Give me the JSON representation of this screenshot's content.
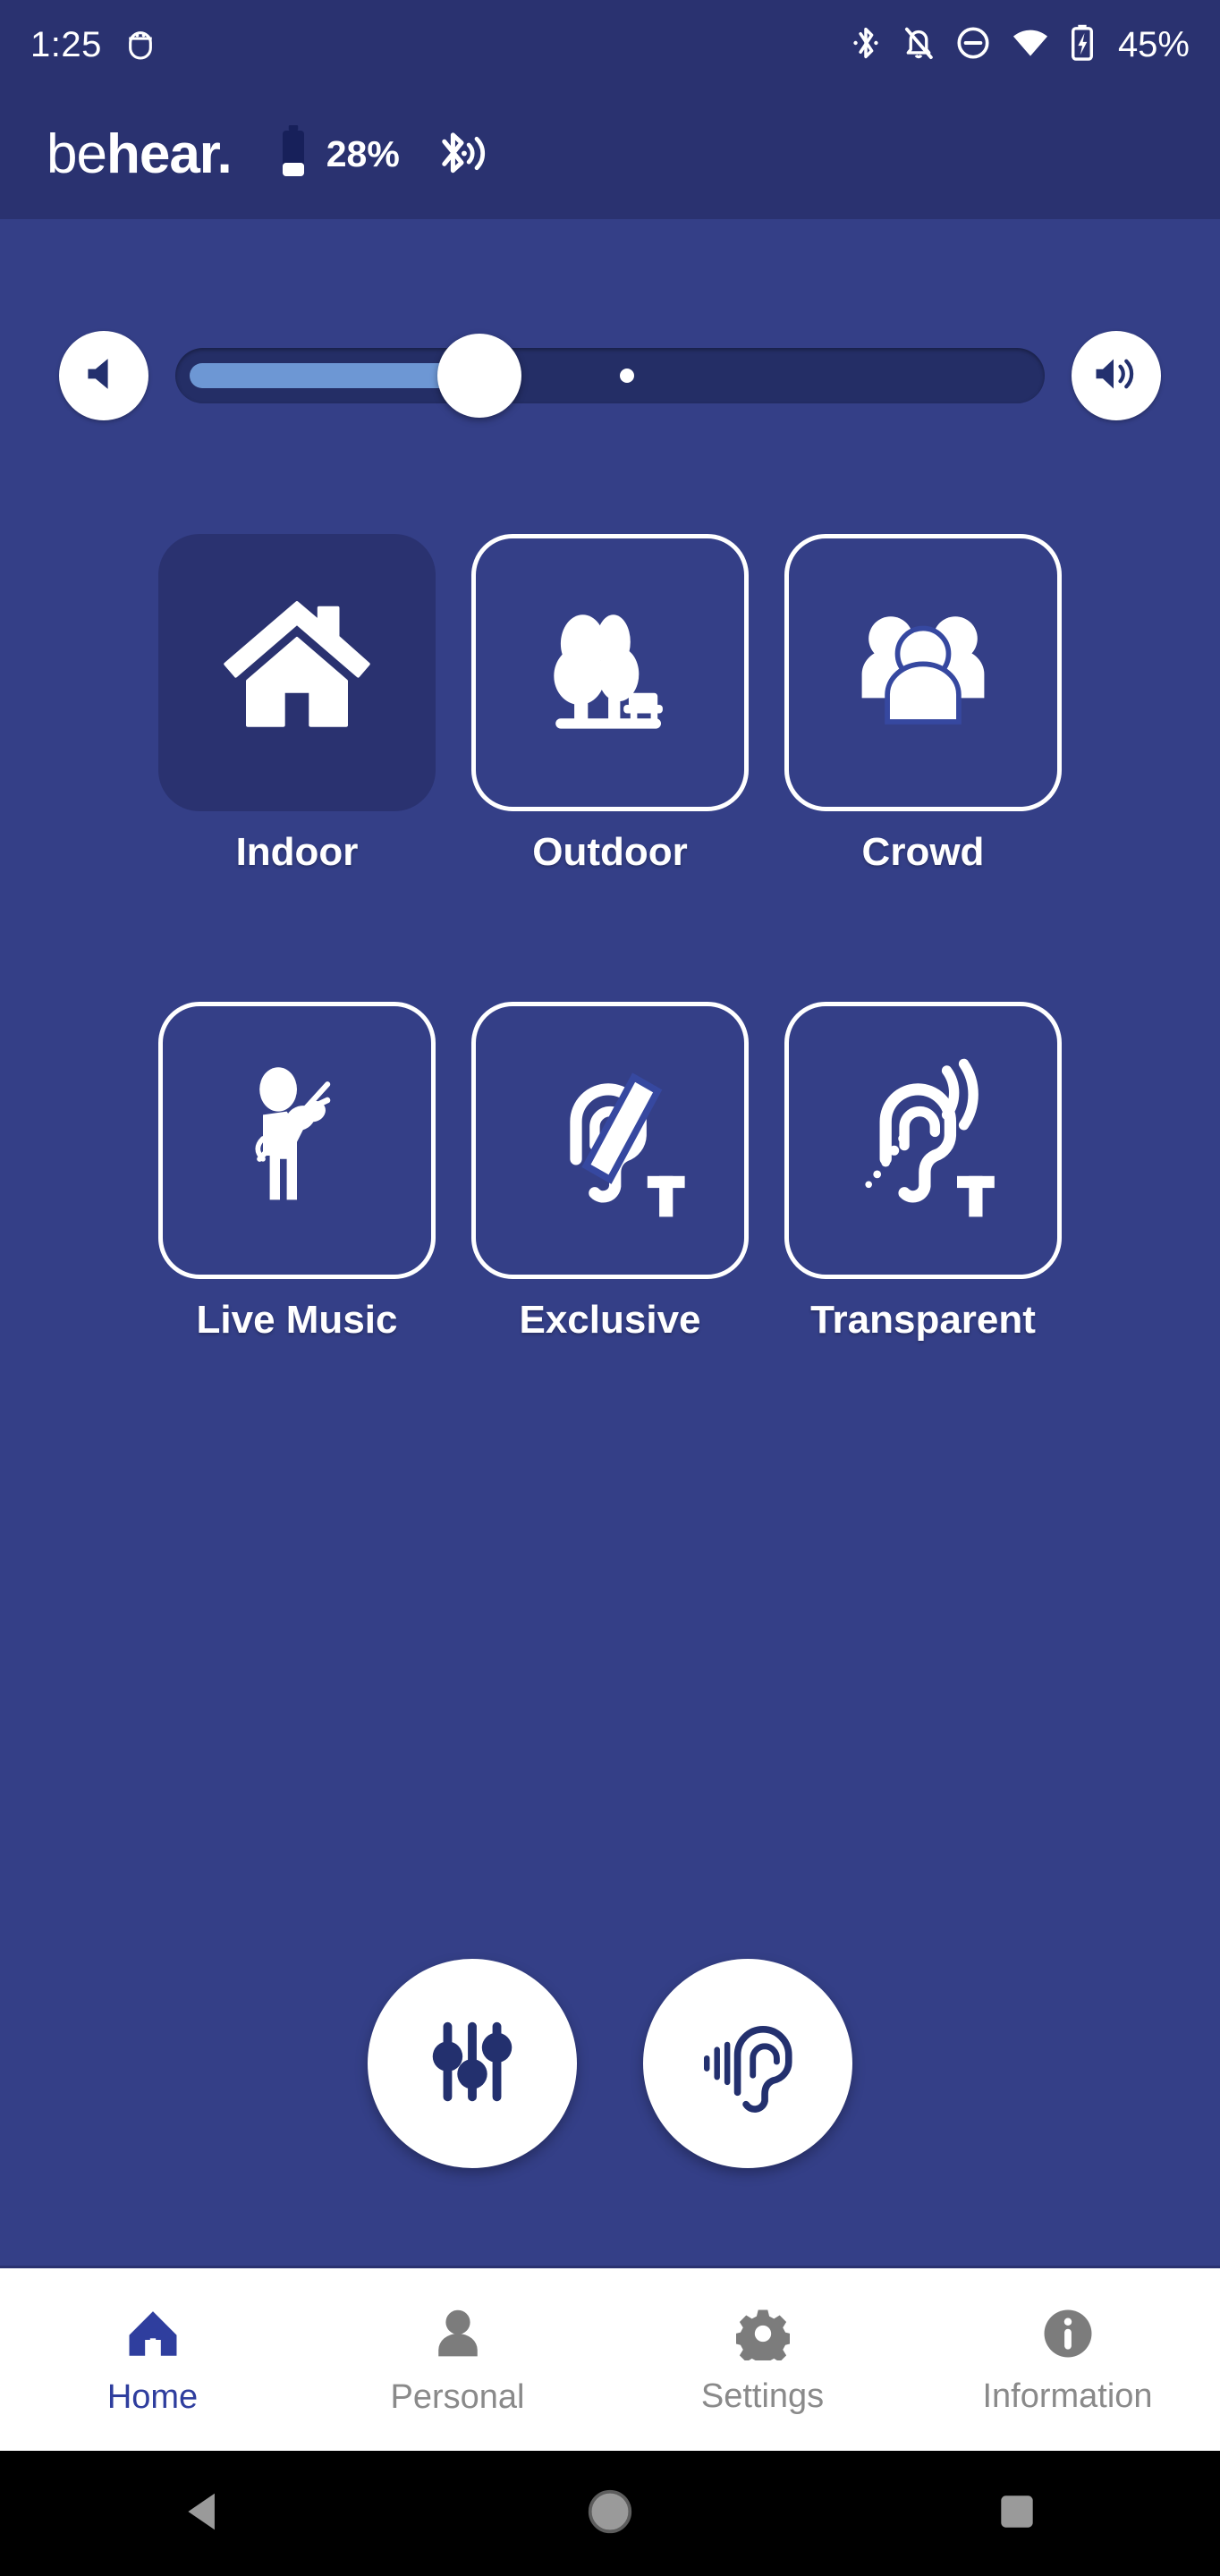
{
  "status_bar": {
    "clock": "1:25",
    "battery_percent": "45%",
    "icons": [
      "android-debug-icon",
      "bluetooth-icon",
      "notifications-off-icon",
      "do-not-disturb-icon",
      "wifi-icon",
      "battery-charging-icon"
    ],
    "background_color": "#2a3270",
    "text_color": "#ffffff"
  },
  "app_header": {
    "logo_light": "be",
    "logo_bold": "hear.",
    "device_battery_percent": "28%",
    "bluetooth_state_icon": "bluetooth-connected-icon",
    "background_color": "#2a3270"
  },
  "volume": {
    "decrease_icon": "volume-down-icon",
    "increase_icon": "volume-up-icon",
    "value_percent": 35,
    "default_marker_percent": 52,
    "track_color": "#242e66",
    "fill_color": "#6d97d4",
    "thumb_color": "#ffffff"
  },
  "modes": {
    "selected": "Indoor",
    "row1": [
      {
        "label": "Indoor",
        "icon": "house-icon",
        "selected": true
      },
      {
        "label": "Outdoor",
        "icon": "trees-bench-icon",
        "selected": false
      },
      {
        "label": "Crowd",
        "icon": "people-group-icon",
        "selected": false
      }
    ],
    "row2": [
      {
        "label": "Live Music",
        "icon": "violinist-icon",
        "selected": false
      },
      {
        "label": "Exclusive",
        "icon": "ear-telecoil-blocked-icon",
        "selected": false
      },
      {
        "label": "Transparent",
        "icon": "ear-telecoil-waves-icon",
        "selected": false
      }
    ]
  },
  "floating_actions": [
    {
      "name": "equalizer",
      "icon": "equalizer-sliders-icon"
    },
    {
      "name": "hearing-assessment",
      "icon": "ear-hearing-icon"
    }
  ],
  "bottom_nav": {
    "active": "Home",
    "active_color": "#2f3e9e",
    "inactive_color": "#8a8a8a",
    "items": [
      {
        "label": "Home",
        "icon": "home-icon",
        "active": true
      },
      {
        "label": "Personal",
        "icon": "person-icon",
        "active": false
      },
      {
        "label": "Settings",
        "icon": "gear-icon",
        "active": false
      },
      {
        "label": "Information",
        "icon": "info-circle-icon",
        "active": false
      }
    ]
  },
  "system_nav": {
    "buttons": [
      {
        "name": "back",
        "icon": "triangle-back-icon"
      },
      {
        "name": "home",
        "icon": "circle-home-icon"
      },
      {
        "name": "recents",
        "icon": "square-recents-icon"
      }
    ]
  },
  "theme": {
    "body_background": "#343f87",
    "header_background": "#2a3270",
    "selected_card_background": "#2a3270",
    "white": "#ffffff"
  }
}
